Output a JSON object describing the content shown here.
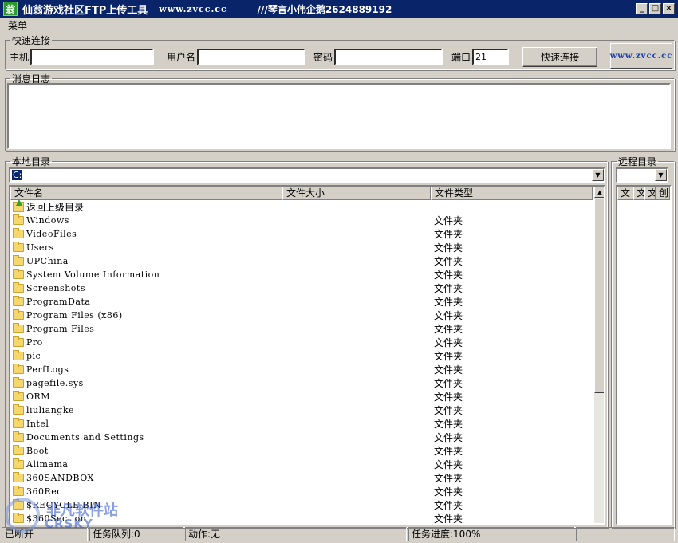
{
  "titlebar": {
    "title": "仙翁游戏社区FTP上传工具",
    "url": "www.zvcc.cc",
    "extra": "///琴言小伟企鹅2624889192",
    "minimize": "_",
    "maximize": "□",
    "close": "×"
  },
  "menu": {
    "label": "菜单"
  },
  "quick_connect": {
    "legend": "快速连接",
    "host_label": "主机",
    "host_value": "",
    "user_label": "用户名",
    "user_value": "",
    "password_label": "密码",
    "password_value": "",
    "port_label": "端口",
    "port_value": "21",
    "connect_button": "快速连接",
    "site_button": "www.zvcc.cc"
  },
  "log": {
    "legend": "消息日志"
  },
  "local": {
    "legend": "本地目录",
    "path": "C:",
    "columns": [
      "文件名",
      "文件大小",
      "文件类型"
    ],
    "parent_label": "返回上级目录",
    "items": [
      {
        "name": "Windows",
        "type": "文件夹"
      },
      {
        "name": "VideoFiles",
        "type": "文件夹"
      },
      {
        "name": "Users",
        "type": "文件夹"
      },
      {
        "name": "UPChina",
        "type": "文件夹"
      },
      {
        "name": "System Volume Information",
        "type": "文件夹"
      },
      {
        "name": "Screenshots",
        "type": "文件夹"
      },
      {
        "name": "ProgramData",
        "type": "文件夹"
      },
      {
        "name": "Program Files (x86)",
        "type": "文件夹"
      },
      {
        "name": "Program Files",
        "type": "文件夹"
      },
      {
        "name": "Pro",
        "type": "文件夹"
      },
      {
        "name": "pic",
        "type": "文件夹"
      },
      {
        "name": "PerfLogs",
        "type": "文件夹"
      },
      {
        "name": "pagefile.sys",
        "type": "文件夹"
      },
      {
        "name": "ORM",
        "type": "文件夹"
      },
      {
        "name": "liuliangke",
        "type": "文件夹"
      },
      {
        "name": "Intel",
        "type": "文件夹"
      },
      {
        "name": "Documents and Settings",
        "type": "文件夹"
      },
      {
        "name": "Boot",
        "type": "文件夹"
      },
      {
        "name": "Alimama",
        "type": "文件夹"
      },
      {
        "name": "360SANDBOX",
        "type": "文件夹"
      },
      {
        "name": "360Rec",
        "type": "文件夹"
      },
      {
        "name": "$RECYCLE.BIN",
        "type": "文件夹"
      },
      {
        "name": "$360Section",
        "type": "文件夹"
      }
    ]
  },
  "remote": {
    "legend": "远程目录",
    "columns": [
      "文",
      "文",
      "文",
      "创"
    ]
  },
  "status": {
    "connection": "已断开",
    "queue": "任务队列:0",
    "action": "动作:无",
    "progress": "任务进度:100%"
  },
  "watermark": {
    "cn": "非凡软件站",
    "en": "CRSKY"
  }
}
